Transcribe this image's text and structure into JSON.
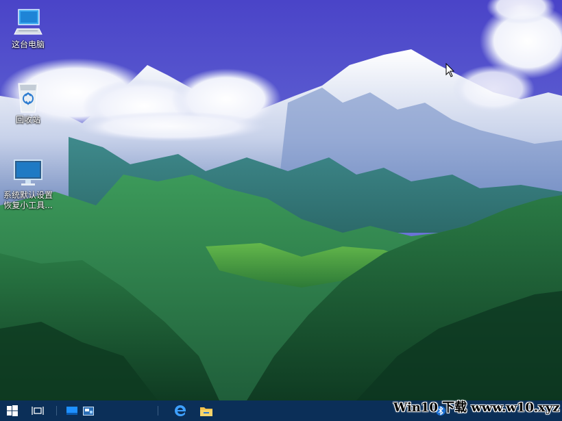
{
  "desktop_icons": [
    {
      "label": "这台电脑",
      "icon": "computer-icon"
    },
    {
      "label": "回收站",
      "icon": "recycle-bin-icon"
    },
    {
      "label": "系统默认设置\n恢复小工具...",
      "icon": "monitor-icon"
    }
  ],
  "taskbar": {
    "start": "windows-logo-icon",
    "task_view": "task-view-icon",
    "quick_apps": [
      "desktop-icon",
      "display-icon"
    ],
    "pinned": [
      "edge-icon",
      "file-explorer-icon"
    ],
    "tray": [
      "bluetooth-icon",
      "network-icon",
      "volume-icon"
    ]
  },
  "watermark": "Win10 下载 www.w10.xyz",
  "colors": {
    "taskbar": "#0b2f58",
    "accent": "#1e90ff"
  }
}
